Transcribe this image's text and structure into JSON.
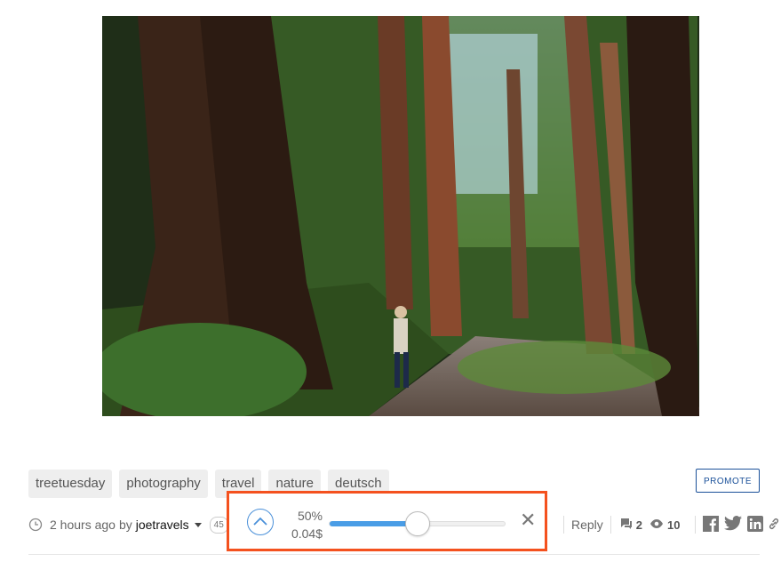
{
  "tags": [
    "treetuesday",
    "photography",
    "travel",
    "nature",
    "deutsch"
  ],
  "promote_label": "PROMOTE",
  "meta": {
    "time": "2 hours ago",
    "by": "by",
    "author": "joetravels",
    "reputation": "45"
  },
  "vote": {
    "percent_label": "50%",
    "payout_label": "0.04$",
    "percent_value": 50,
    "close_glyph": "✕"
  },
  "actions": {
    "reply_label": "Reply",
    "comments_count": "2",
    "views_count": "10"
  },
  "colors": {
    "accent": "#4a9de6",
    "highlight_border": "#f4511e",
    "promote": "#1a5099"
  },
  "icons": [
    "clock-icon",
    "upvote-chevron-icon",
    "comments-icon",
    "eye-icon",
    "facebook-icon",
    "twitter-icon",
    "linkedin-icon",
    "link-icon"
  ]
}
